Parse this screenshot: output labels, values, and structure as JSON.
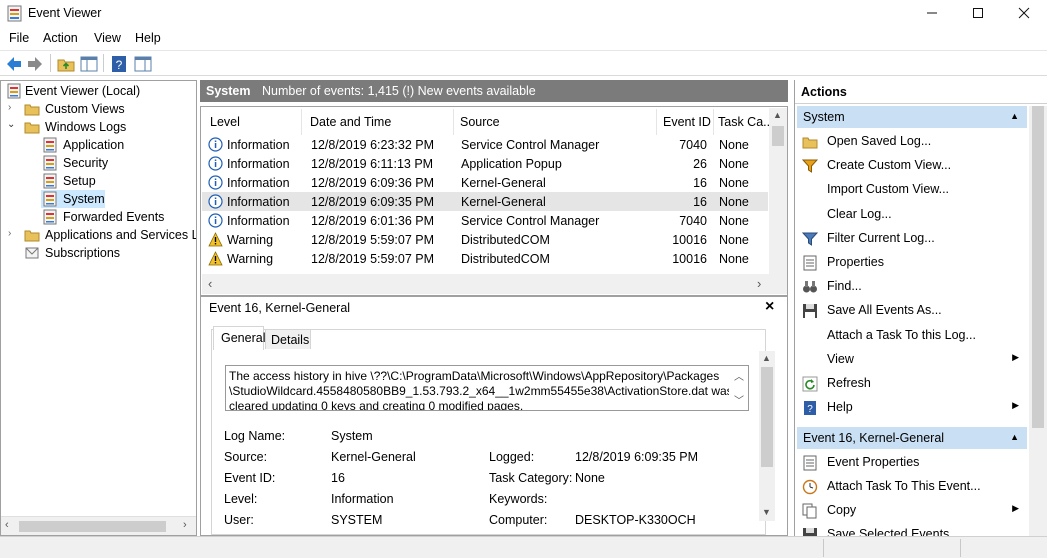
{
  "window": {
    "title": "Event Viewer"
  },
  "menu": [
    "File",
    "Action",
    "View",
    "Help"
  ],
  "tree": {
    "root": "Event Viewer (Local)",
    "custom_views": "Custom Views",
    "windows_logs": "Windows Logs",
    "application": "Application",
    "security": "Security",
    "setup": "Setup",
    "system": "System",
    "forwarded": "Forwarded Events",
    "apps_services": "Applications and Services Lo",
    "subscriptions": "Subscriptions"
  },
  "list_header": {
    "name": "System",
    "info": "Number of events: 1,415 (!) New events available"
  },
  "columns": {
    "level": "Level",
    "date": "Date and Time",
    "source": "Source",
    "event_id": "Event ID",
    "task": "Task Ca..."
  },
  "events": [
    {
      "level": "Information",
      "date": "12/8/2019 6:23:32 PM",
      "source": "Service Control Manager",
      "id": "7040",
      "task": "None",
      "type": "info"
    },
    {
      "level": "Information",
      "date": "12/8/2019 6:11:13 PM",
      "source": "Application Popup",
      "id": "26",
      "task": "None",
      "type": "info"
    },
    {
      "level": "Information",
      "date": "12/8/2019 6:09:36 PM",
      "source": "Kernel-General",
      "id": "16",
      "task": "None",
      "type": "info"
    },
    {
      "level": "Information",
      "date": "12/8/2019 6:09:35 PM",
      "source": "Kernel-General",
      "id": "16",
      "task": "None",
      "type": "info"
    },
    {
      "level": "Information",
      "date": "12/8/2019 6:01:36 PM",
      "source": "Service Control Manager",
      "id": "7040",
      "task": "None",
      "type": "info"
    },
    {
      "level": "Warning",
      "date": "12/8/2019 5:59:07 PM",
      "source": "DistributedCOM",
      "id": "10016",
      "task": "None",
      "type": "warning"
    },
    {
      "level": "Warning",
      "date": "12/8/2019 5:59:07 PM",
      "source": "DistributedCOM",
      "id": "10016",
      "task": "None",
      "type": "warning"
    }
  ],
  "detail": {
    "title": "Event 16, Kernel-General",
    "close": "×",
    "tabs": {
      "general": "General",
      "details": "Details"
    },
    "description": [
      "The access history in hive \\??\\C:\\ProgramData\\Microsoft\\Windows\\AppRepository\\Packages",
      "\\StudioWildcard.4558480580BB9_1.53.793.2_x64__1w2mm55455e38\\ActivationStore.dat was",
      "cleared updating 0 keys and creating 0 modified pages."
    ],
    "fields": {
      "log_name_label": "Log Name:",
      "log_name": "System",
      "source_label": "Source:",
      "source": "Kernel-General",
      "logged_label": "Logged:",
      "logged": "12/8/2019 6:09:35 PM",
      "event_id_label": "Event ID:",
      "event_id": "16",
      "task_label": "Task Category:",
      "task": "None",
      "level_label": "Level:",
      "level": "Information",
      "keywords_label": "Keywords:",
      "keywords": "",
      "user_label": "User:",
      "user": "SYSTEM",
      "computer_label": "Computer:",
      "computer": "DESKTOP-K330OCH"
    }
  },
  "actions": {
    "title": "Actions",
    "section1": "System",
    "items1": [
      {
        "label": "Open Saved Log...",
        "icon": "folder-icon",
        "submenu": false
      },
      {
        "label": "Create Custom View...",
        "icon": "funnel-icon",
        "submenu": false
      },
      {
        "label": "Import Custom View...",
        "icon": "",
        "submenu": false
      },
      {
        "label": "Clear Log...",
        "icon": "",
        "submenu": false
      },
      {
        "label": "Filter Current Log...",
        "icon": "filter-icon",
        "submenu": false
      },
      {
        "label": "Properties",
        "icon": "properties-icon",
        "submenu": false
      },
      {
        "label": "Find...",
        "icon": "binoculars-icon",
        "submenu": false
      },
      {
        "label": "Save All Events As...",
        "icon": "save-icon",
        "submenu": false
      },
      {
        "label": "Attach a Task To this Log...",
        "icon": "",
        "submenu": false
      },
      {
        "label": "View",
        "icon": "",
        "submenu": true
      },
      {
        "label": "Refresh",
        "icon": "refresh-icon",
        "submenu": false
      },
      {
        "label": "Help",
        "icon": "help-icon",
        "submenu": true
      }
    ],
    "section2": "Event 16, Kernel-General",
    "items2": [
      {
        "label": "Event Properties",
        "icon": "properties-icon",
        "submenu": false
      },
      {
        "label": "Attach Task To This Event...",
        "icon": "task-icon",
        "submenu": false
      },
      {
        "label": "Copy",
        "icon": "copy-icon",
        "submenu": true
      },
      {
        "label": "Save Selected Events...",
        "icon": "save-icon",
        "submenu": false
      }
    ]
  },
  "colors": {
    "accent": "#cce8ff",
    "section": "#c9dff3",
    "header": "#7b7b7b"
  }
}
